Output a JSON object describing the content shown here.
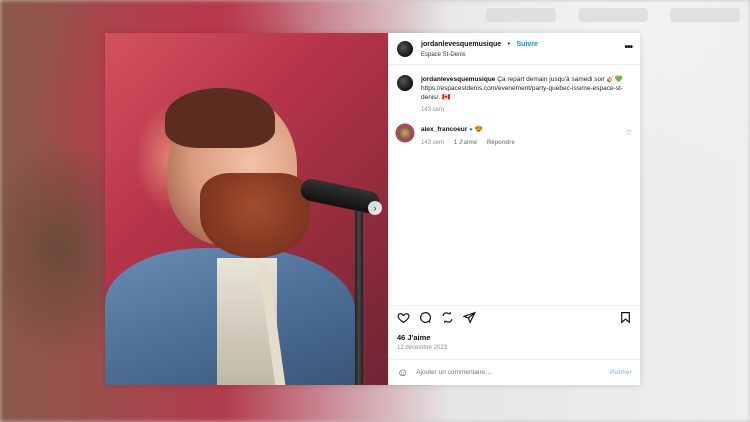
{
  "post": {
    "author": "jordanlevesquemusique",
    "separator": "•",
    "follow_label": "Suivre",
    "location": "Espace St-Denis",
    "more_label": "•••",
    "caption": {
      "author": "jordanlevesquemusique",
      "text": "Ça repart demain jusqu'à samedi soir 🎸💚",
      "link": "https://espacestdenis.com/evenement/party-quebec-issime-espace-st-denis/.",
      "flag": "🇨🇦",
      "age": "143 sem"
    },
    "comments": [
      {
        "author": "alex_francoeur",
        "text": "😍",
        "age": "143 sem",
        "likes": "1 J'aime",
        "reply": "Répondre"
      }
    ],
    "likes": "46 J'aime",
    "date": "12 décembre 2023",
    "add_comment_placeholder": "Ajouter un commentaire…",
    "publish_label": "Publier",
    "next_label": "›"
  },
  "colors": {
    "accent": "#0095f6",
    "muted": "#8e8e8e",
    "publish_disabled": "#9fc8f4"
  }
}
